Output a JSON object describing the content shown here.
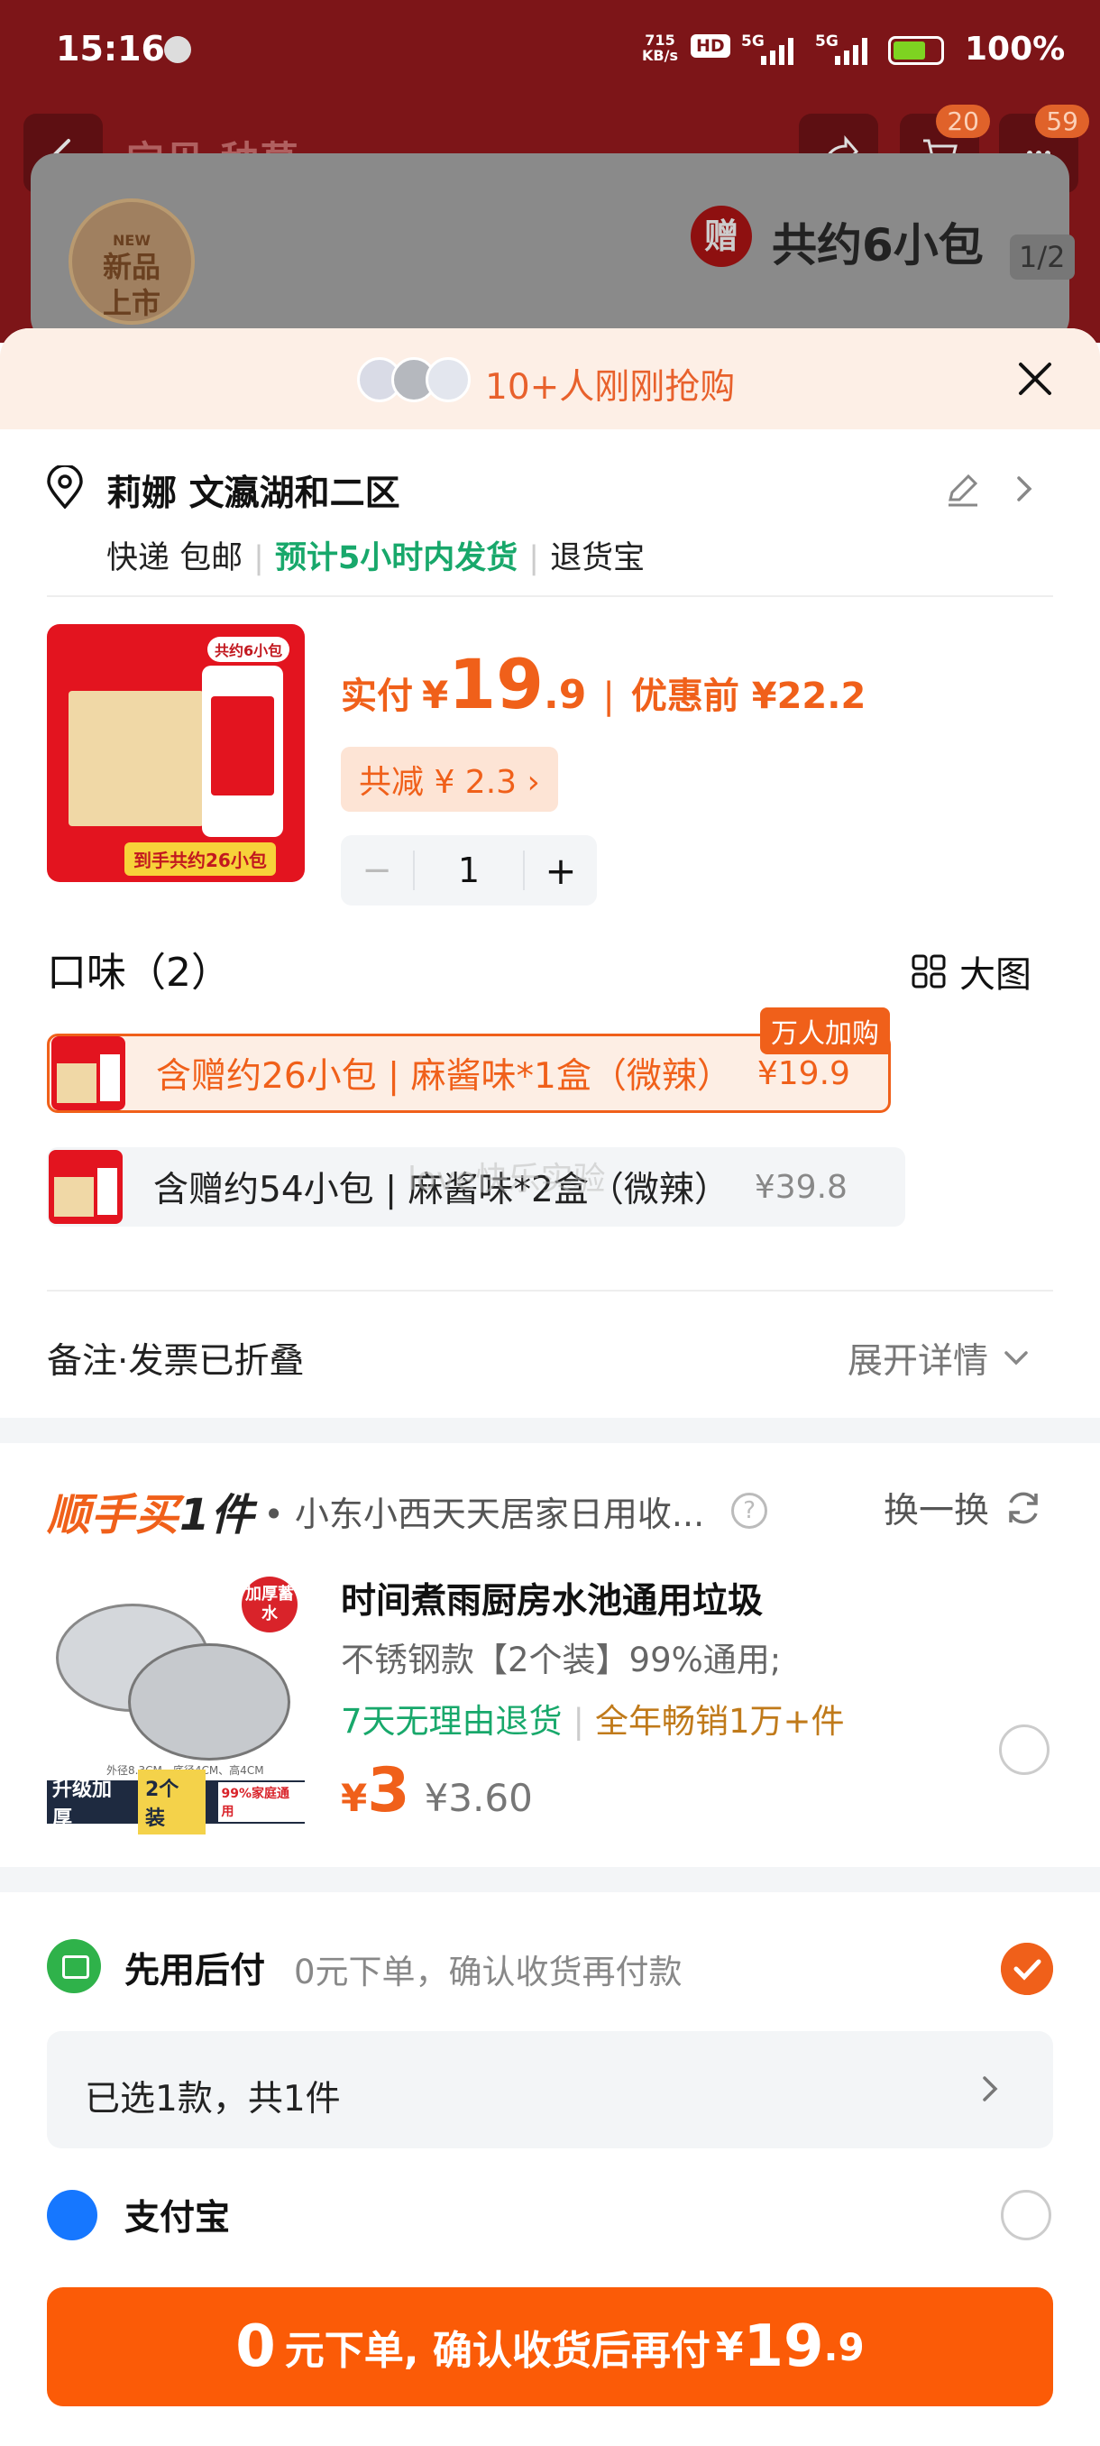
{
  "status_bar": {
    "time": "15:16",
    "net_speed_top": "715",
    "net_speed_bottom": "KB/s",
    "hd": "HD",
    "sig1": "5G",
    "sig2": "5G",
    "battery": "100%"
  },
  "background_page": {
    "tabs": "宝贝  种草",
    "cart_count": "20",
    "msg_count": "59",
    "new_badge": "新品上市",
    "new_small": "NEW",
    "gift_icon_text": "赠",
    "gift_text": "共约6小包",
    "page_indicator": "1/2"
  },
  "buzz": {
    "text": "10+人刚刚抢购"
  },
  "address": {
    "name": "莉娜 文瀛湖和二区",
    "shipping": "快递 包邮",
    "eta": "预计5小时内发货",
    "return": "退货宝"
  },
  "product": {
    "pay_label": "实付",
    "currency": "¥",
    "price_int": "19",
    "price_dec": ".9",
    "orig_sep": "|",
    "orig_price": "优惠前 ¥22.2",
    "discount": "共减 ¥ 2.3 ›",
    "img_top": "共约6小包",
    "img_tag": "到手共约26小包",
    "quantity": "1",
    "minus": "−",
    "plus": "+"
  },
  "flavor": {
    "title": "口味（2）",
    "big_view": "大图",
    "options": [
      {
        "label": "含赠约26小包 | 麻酱味*1盒（微辣）",
        "price": "¥19.9",
        "badge": "万人加购",
        "selected": true
      },
      {
        "label": "含赠约54小包 | 麻酱味*2盒（微辣）",
        "price": "¥39.8",
        "selected": false
      }
    ]
  },
  "watermark": "love快乐实验",
  "note": {
    "left": "备注·发票已折叠",
    "right": "展开详情"
  },
  "addon": {
    "logo_prefix": "顺手买",
    "logo_suffix": "1件",
    "store": "• 小东小西天天居家日用收...",
    "help": "?",
    "swap": "换一换",
    "title": "时间煮雨厨房水池通用垃圾",
    "spec": "不锈钢款【2个装】99%通用;",
    "return_policy": "7天无理由退货",
    "sales": "全年畅销1万+件",
    "currency": "¥",
    "price": "3",
    "old_price": "¥3.60",
    "thick_badge": "加厚蓄水",
    "strip_a": "升级加厚",
    "strip_b": "2个装",
    "strip_c": "99%家庭通用",
    "dims": "外径8.3CM、底径4CM、高4CM"
  },
  "payment": {
    "method": "先用后付",
    "method_desc": "0元下单，确认收货再付款",
    "selected_summary": "已选1款，共1件",
    "alt_method": "支付宝"
  },
  "cta": {
    "zero": "0",
    "text": "元下单, 确认收货后再付",
    "currency": "¥",
    "int": "19",
    "dec": ".9"
  },
  "colors": {
    "accent": "#f0601a",
    "cta": "#fb5b07",
    "green": "#18a86b",
    "bg_red": "#7d1518"
  }
}
